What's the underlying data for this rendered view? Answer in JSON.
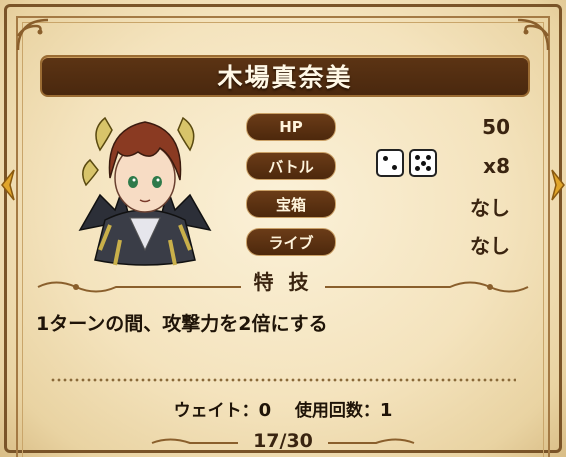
{
  "card": {
    "name": "木場真奈美",
    "stats": [
      {
        "label": "HP",
        "value": "50"
      },
      {
        "label": "バトル",
        "value": "x8"
      },
      {
        "label": "宝箱",
        "value": "なし"
      },
      {
        "label": "ライブ",
        "value": "なし"
      }
    ],
    "dice_faces": [
      2,
      5
    ],
    "skill_heading": "特 技",
    "skill_description": "1ターンの間、攻撃力を2倍にする",
    "wait_label": "ウェイト：",
    "wait_value": "0",
    "uses_label": "使用回数：",
    "uses_value": "1",
    "page_indicator": "17/30"
  },
  "colors": {
    "parchment": "#f4e3bd",
    "frame_brown": "#7a5428",
    "pill_brown": "#5c3414",
    "text_dark": "#3a2410"
  }
}
